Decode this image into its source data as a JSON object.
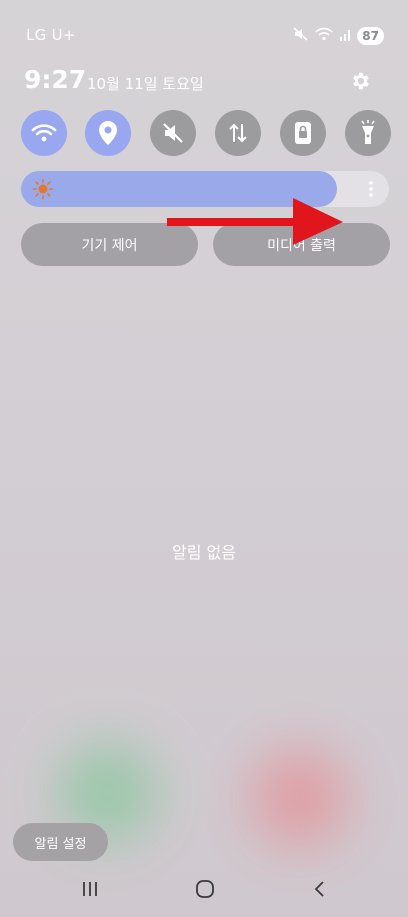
{
  "status_bar": {
    "carrier": "LG U+",
    "battery": "87",
    "icons": [
      "mute-icon",
      "wifi-icon",
      "signal-icon",
      "battery-icon"
    ]
  },
  "header": {
    "time": "9:27",
    "date": "10월 11일 토요일",
    "settings_icon": "gear-icon"
  },
  "quick_settings": [
    {
      "icon": "wifi-icon",
      "active": true
    },
    {
      "icon": "location-icon",
      "active": true
    },
    {
      "icon": "mute-icon",
      "active": false
    },
    {
      "icon": "mobile-data-icon",
      "active": false
    },
    {
      "icon": "rotation-lock-icon",
      "active": false
    },
    {
      "icon": "flashlight-icon",
      "active": false
    }
  ],
  "brightness": {
    "level": 0.86,
    "icon": "sun-icon",
    "more_icon": "more-vertical-icon"
  },
  "buttons": {
    "device_control": "기기 제어",
    "media_output": "미디어 출력"
  },
  "empty_message": "알림 없음",
  "notification_settings": "알림 설정",
  "nav": [
    "recent-apps-icon",
    "home-icon",
    "back-icon"
  ],
  "colors": {
    "accent": "#98a7ef",
    "tile_off": "#9c9c9f",
    "arrow": "#e0161c"
  }
}
